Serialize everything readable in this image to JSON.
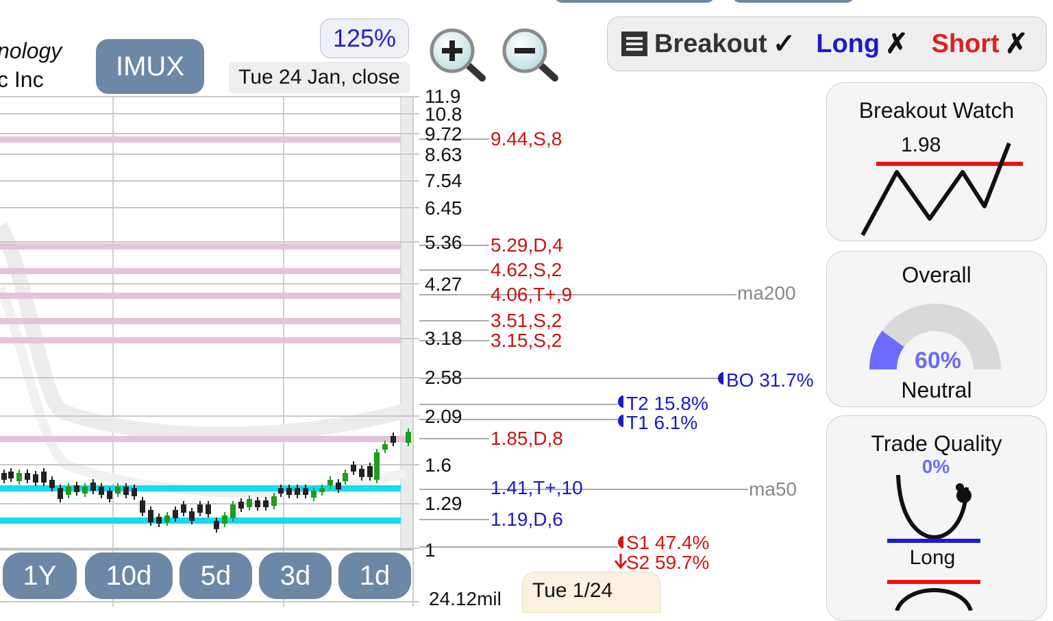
{
  "company": {
    "line1": "nology",
    "line2": "c Inc"
  },
  "ticker": "IMUX",
  "zoom_level": "125%",
  "chart_date": "Tue 24 Jan, close",
  "toggles": [
    {
      "label": "Breakout",
      "mark": "✓",
      "color": "#333333"
    },
    {
      "label": "Long",
      "mark": "✗",
      "color": "#1a1acc"
    },
    {
      "label": "Short",
      "mark": "✗",
      "color": "#e02020"
    }
  ],
  "icons": {
    "menu": "menu-icon",
    "zoom_in": "zoom-in-icon",
    "zoom_out": "zoom-out-icon"
  },
  "price_ticks": [
    "11.9",
    "10.8",
    "9.72",
    "8.63",
    "7.54",
    "6.45",
    "5.36",
    "4.27",
    "3.18",
    "2.58",
    "2.09",
    "1.6",
    "1.29",
    "1"
  ],
  "annotations": [
    {
      "text": "9.44,S,8",
      "color": "red"
    },
    {
      "text": "5.29,D,4",
      "color": "red"
    },
    {
      "text": "4.62,S,2",
      "color": "red"
    },
    {
      "text": "4.06,T+,9",
      "color": "red"
    },
    {
      "text": "3.51,S,2",
      "color": "red"
    },
    {
      "text": "3.15,S,2",
      "color": "red"
    },
    {
      "text": "1.85,D,8",
      "color": "red"
    },
    {
      "text": "1.41,T+,10",
      "color": "blue"
    },
    {
      "text": "1.19,D,6",
      "color": "blue"
    }
  ],
  "moving_averages": {
    "ma200": "ma200",
    "ma50": "ma50"
  },
  "targets": {
    "bo": "BO 31.7%",
    "t2": "T2 15.8%",
    "t1": "T1 6.1%",
    "s1": "S1 47.4%",
    "s2": "S2 59.7%"
  },
  "periods": [
    "1Y",
    "10d",
    "5d",
    "3d",
    "1d"
  ],
  "bottom_date": "Tue 1/24",
  "volume_label": "24.12mil",
  "panels": {
    "breakout_watch": {
      "title": "Breakout Watch",
      "value": "1.98"
    },
    "overall": {
      "title": "Overall",
      "percent": "60%",
      "percent_value": 0.6,
      "rating": "Neutral"
    },
    "trade_quality": {
      "title": "Trade Quality",
      "percent": "0%",
      "long_label": "Long"
    }
  },
  "colors": {
    "pill": "#6d87a6",
    "resistance_band": "#e6c3dc",
    "support_band": "#17d9f2",
    "up_candle": "#1d9c1d",
    "down_candle": "#222222",
    "gauge_fill": "#6b6bff"
  }
}
